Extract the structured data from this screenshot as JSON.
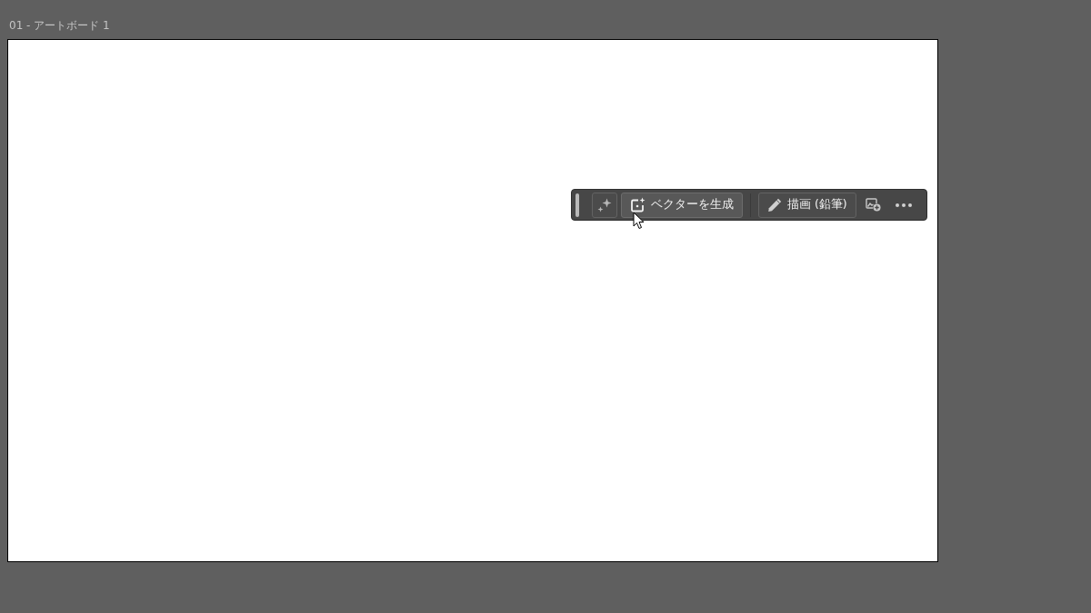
{
  "artboard": {
    "label": "01 - アートボード 1"
  },
  "toolbar": {
    "items": [
      {
        "kind": "grip"
      },
      {
        "kind": "sparkle",
        "hovered": false
      },
      {
        "kind": "generate",
        "label": "ベクターを生成",
        "hovered": true
      },
      {
        "kind": "divider"
      },
      {
        "kind": "pencil",
        "label": "描画 (鉛筆)",
        "hovered": false
      },
      {
        "kind": "image"
      },
      {
        "kind": "more"
      }
    ]
  }
}
